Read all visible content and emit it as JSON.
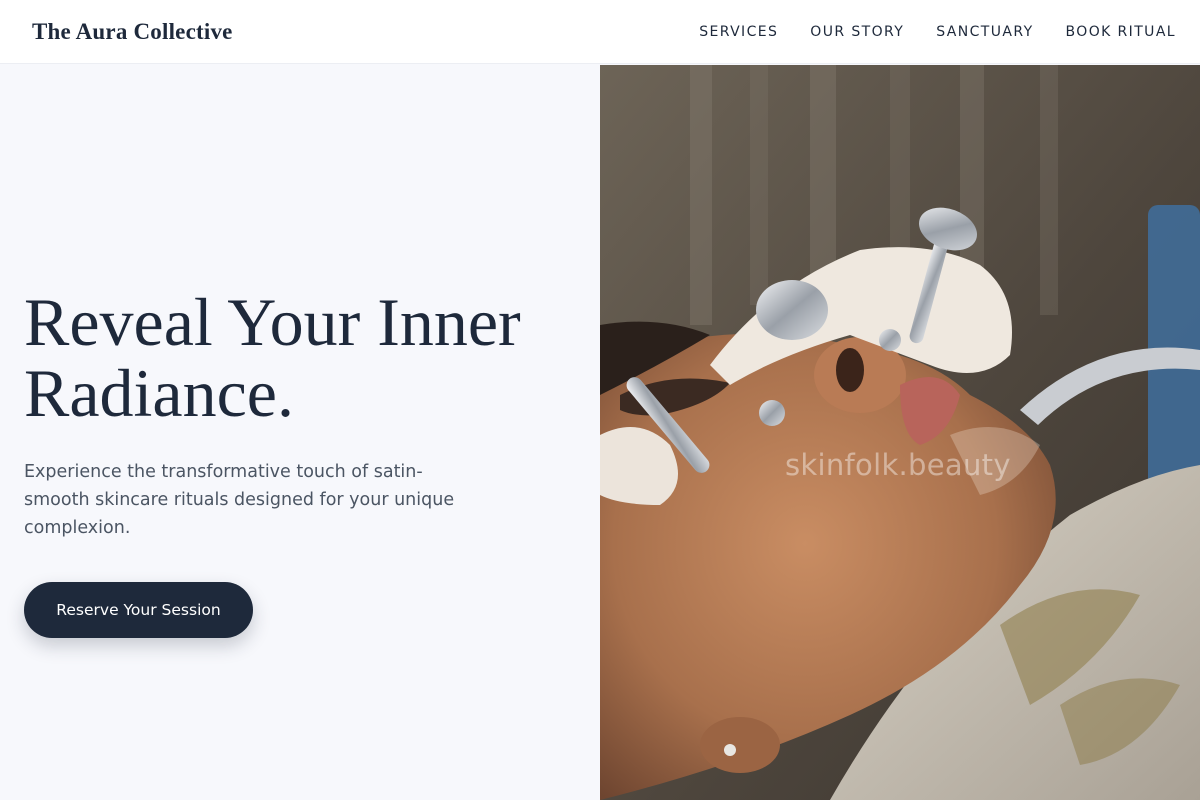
{
  "header": {
    "brand": "The Aura Collective",
    "nav": [
      {
        "label": "SERVICES"
      },
      {
        "label": "OUR STORY"
      },
      {
        "label": "SANCTUARY"
      },
      {
        "label": "BOOK RITUAL"
      }
    ]
  },
  "hero": {
    "headline_line1": "Reveal Your Inner",
    "headline_line2": "Radiance.",
    "subtext": "Experience the transformative touch of satin-smooth skincare rituals designed for your unique complexion.",
    "cta_label": "Reserve Your Session",
    "image_watermark": "skinfolk.beauty"
  },
  "colors": {
    "brand_navy": "#1e293b",
    "page_background": "#f7f8fc",
    "subtext": "#4b5563"
  }
}
